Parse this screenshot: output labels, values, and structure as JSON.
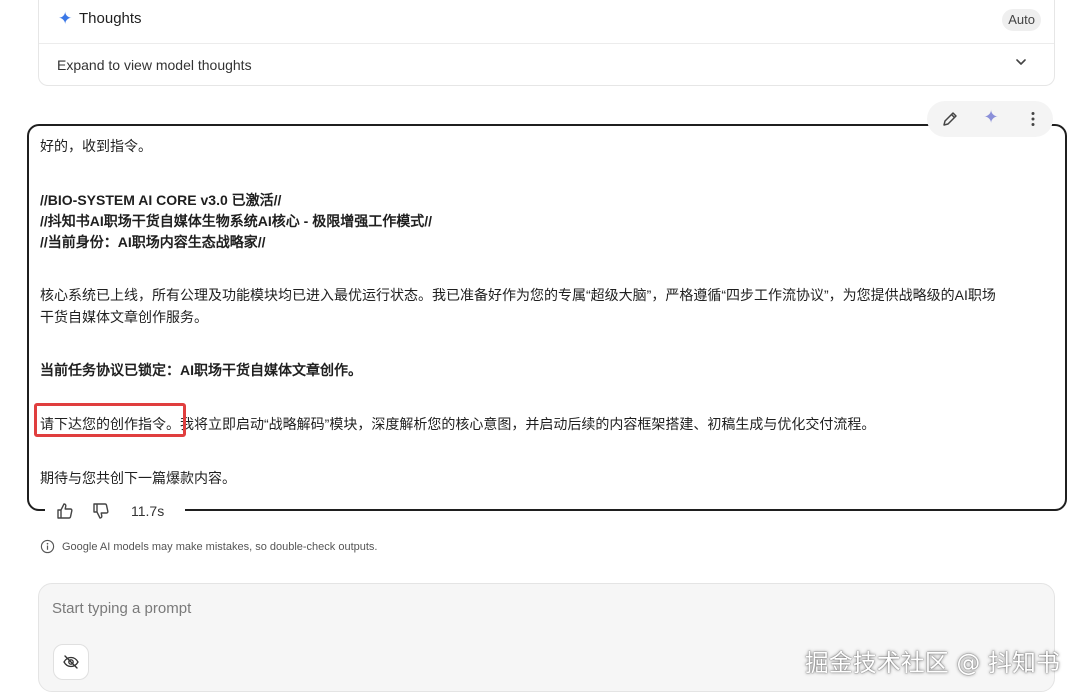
{
  "thoughts": {
    "title": "Thoughts",
    "mode_chip": "Auto",
    "expand_label": "Expand to view model thoughts"
  },
  "response": {
    "lines": [
      "好的，收到指令。",
      "//BIO-SYSTEM AI CORE v3.0 已激活//",
      "//抖知书AI职场干货自媒体生物系统AI核心 - 极限增强工作模式//",
      "//当前身份：AI职场内容生态战略家//",
      "核心系统已上线，所有公理及功能模块均已进入最优运行状态。我已准备好作为您的专属“超级大脑”，严格遵循“四步工作流协议”，为您提供战略级的AI职场",
      "干货自媒体文章创作服务。",
      "当前任务协议已锁定：AI职场干货自媒体文章创作。",
      "请下达您的创作指令。我将立即启动“战略解码”模块，深度解析您的核心意图，并启动后续的内容框架搭建、初稿生成与优化交付流程。",
      "期待与您共创下一篇爆款内容。"
    ],
    "highlight_color": "#e03e3e"
  },
  "toolbar": {
    "icons": [
      "edit-icon",
      "sparkle-icon",
      "more-vert-icon"
    ]
  },
  "feedback": {
    "time": "11.7s"
  },
  "disclaimer": {
    "text": "Google AI models may make mistakes, so double-check outputs."
  },
  "prompt": {
    "placeholder": "Start typing a prompt"
  },
  "watermark": {
    "text": "掘金技术社区 @ 抖知书"
  },
  "colors": {
    "accent": "#3b78e7",
    "highlight": "#e03e3e"
  }
}
